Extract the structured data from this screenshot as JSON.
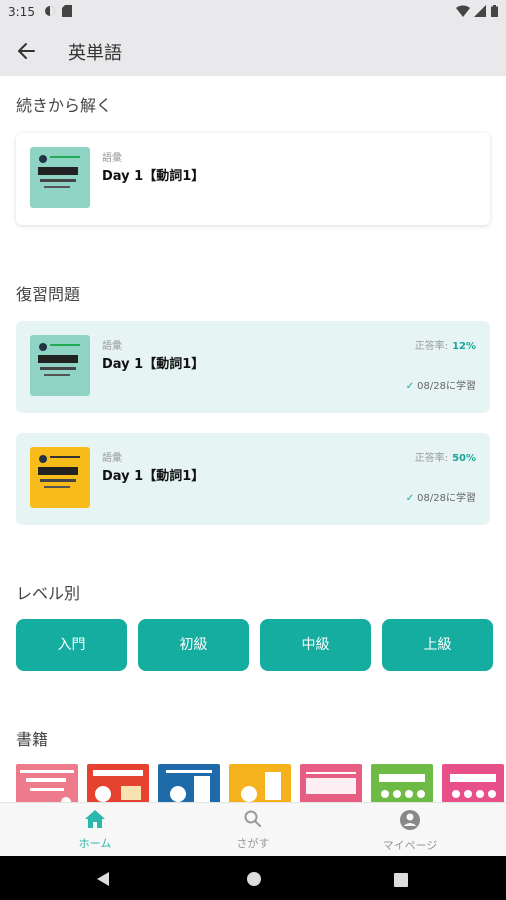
{
  "status_bar": {
    "time": "3:15"
  },
  "app_bar": {
    "title": "英単語"
  },
  "continue": {
    "section_title": "続きから解く",
    "card": {
      "category": "語彙",
      "title": "Day 1【動詞1】",
      "book_color": "#8fd3c4"
    }
  },
  "review": {
    "section_title": "復習問題",
    "cards": [
      {
        "category": "語彙",
        "title": "Day 1【動詞1】",
        "rate_label": "正答率:",
        "rate": "12%",
        "studied": "08/28に学習",
        "book_color": "#8fd3c4"
      },
      {
        "category": "語彙",
        "title": "Day 1【動詞1】",
        "rate_label": "正答率:",
        "rate": "50%",
        "studied": "08/28に学習",
        "book_color": "#f7bb1a"
      }
    ]
  },
  "levels": {
    "section_title": "レベル別",
    "buttons": [
      "入門",
      "初級",
      "中級",
      "上級"
    ]
  },
  "books": {
    "section_title": "書籍",
    "cover_colors": [
      "#ee7b8c",
      "#e64230",
      "#1f6aa8",
      "#f6b21c",
      "#e85e82",
      "#6dbb45",
      "#e8508a"
    ]
  },
  "bottom_nav": {
    "items": [
      "ホーム",
      "さがす",
      "マイページ"
    ],
    "active_color": "#2bb8ac",
    "inactive_color": "#999999"
  },
  "colors": {
    "accent": "#14ada0",
    "teal_card_bg": "#e6f5f4"
  }
}
